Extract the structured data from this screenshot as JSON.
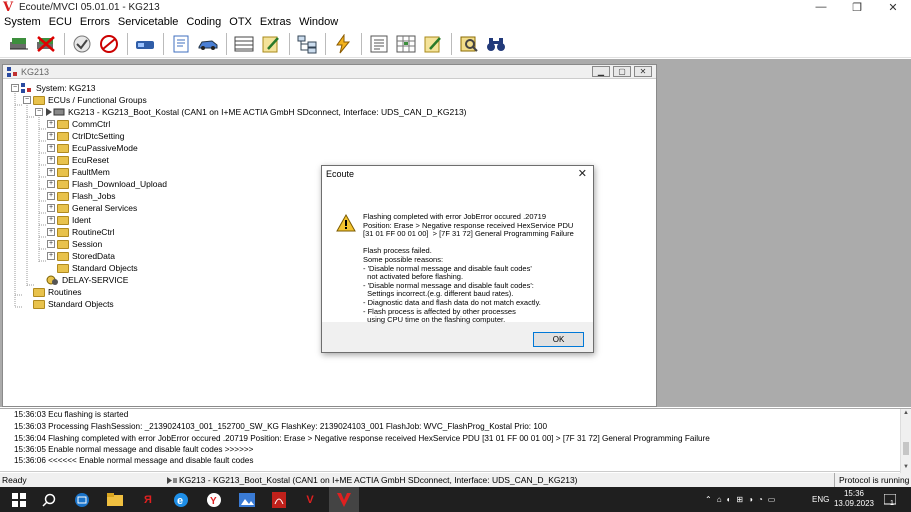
{
  "window": {
    "logo": "V",
    "title": "Ecoute/MVCI 05.01.01 - KG213",
    "minimize": "—",
    "restore": "❐",
    "close": "✕"
  },
  "menu": [
    "System",
    "ECU",
    "Errors",
    "Servicetable",
    "Coding",
    "OTX",
    "Extras",
    "Window"
  ],
  "child_window": {
    "title": "KG213",
    "tree": {
      "root": "System: KG213",
      "group": "ECUs / Functional Groups",
      "ecu": "KG213 - KG213_Boot_Kostal (CAN1 on I+ME ACTIA GmbH SDconnect, Interface: UDS_CAN_D_KG213)",
      "services": [
        "CommCtrl",
        "CtrlDtcSetting",
        "EcuPassiveMode",
        "EcuReset",
        "FaultMem",
        "Flash_Download_Upload",
        "Flash_Jobs",
        "General Services",
        "Ident",
        "RoutineCtrl",
        "Session",
        "StoredData",
        "Standard Objects"
      ],
      "delay": "DELAY-SERVICE",
      "routines": "Routines",
      "standard_objects": "Standard Objects"
    }
  },
  "dialog": {
    "title": "Ecoute",
    "message": "Flashing completed with error JobError occured .20719\nPosition: Erase > Negative response received HexService PDU\n[31 01 FF 00 01 00]  > [7F 31 72] General Programming Failure\n\nFlash process failed.\nSome possible reasons:\n- 'Disable normal message and disable fault codes'\n  not activated before flashing.\n- 'Disable normal message and disable fault codes':\n  Settings incorrect.(e.g. different baud rates).\n- Diagnostic data and flash data do not match exactly.\n- Flash process is affected by other processes\n  using CPU time on the flashing computer.",
    "ok": "OK"
  },
  "log": [
    "15:36:03 Ecu flashing is started",
    "15:36:03 Processing FlashSession: _2139024103_001_152700_SW_KG  FlashKey: 2139024103_001  FlashJob: WVC_FlashProg_Kostal  Prio: 100",
    "15:36:04 Flashing completed with error JobError occured .20719 Position: Erase > Negative response received HexService PDU [31 01 FF 00 01 00]  > [7F 31 72] General Programming Failure",
    "15:36:05 Enable normal message and disable fault codes >>>>>>",
    "15:36:06 <<<<<< Enable normal message and disable fault codes"
  ],
  "status": {
    "ready": "Ready",
    "ecu": "KG213 - KG213_Boot_Kostal (CAN1 on I+ME ACTIA GmbH SDconnect, Interface: UDS_CAN_D_KG213)",
    "protocol": "Protocol is running"
  },
  "taskbar": {
    "language": "ENG",
    "time": "15:36",
    "date": "13.09.2023",
    "notifications": "1"
  },
  "colors": {
    "accent": "#0078d7",
    "logo_red": "#d81e1e",
    "mdi_bg": "#ababab",
    "taskbar": "#1f1f1f"
  }
}
